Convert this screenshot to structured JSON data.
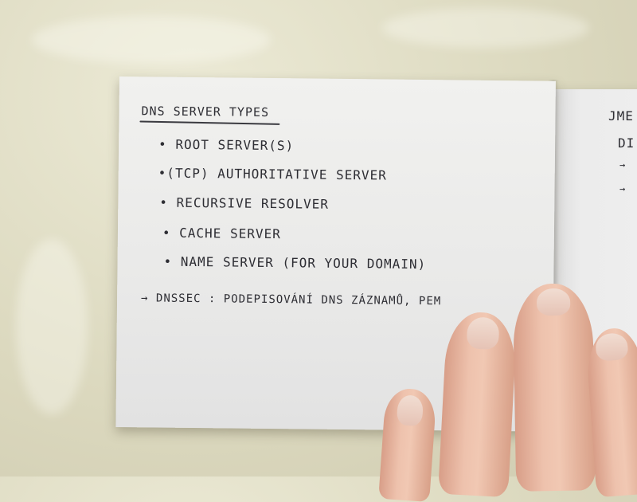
{
  "notebook": {
    "left_page": {
      "heading": "DNS SERVER TYPES",
      "items": [
        "• ROOT SERVER(S)",
        "•(TCP) AUTHORITATIVE SERVER",
        "• RECURSIVE RESOLVER",
        "• CACHE SERVER",
        "• NAME SERVER (FOR YOUR DOMAIN)"
      ],
      "note": "→ DNSSEC : PODEPISOVÁNÍ DNS ZÁZNAMŮ, PEM"
    },
    "right_page": {
      "heading_fragment": "JME",
      "line_fragment": "DI"
    }
  }
}
